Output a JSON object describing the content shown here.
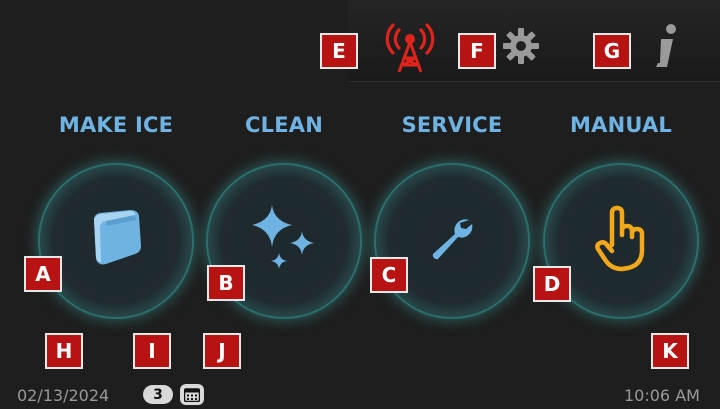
{
  "modes": {
    "make_ice": "MAKE ICE",
    "clean": "CLEAN",
    "service": "SERVICE",
    "manual": "MANUAL"
  },
  "callouts": {
    "a": "A",
    "b": "B",
    "c": "C",
    "d": "D",
    "e": "E",
    "f": "F",
    "g": "G",
    "h": "H",
    "i": "I",
    "j": "J",
    "k": "K"
  },
  "status": {
    "date": "02/13/2024",
    "badge_count": "3",
    "time": "10:06 AM"
  },
  "icons": {
    "signal": "signal-tower-icon",
    "settings": "gear-icon",
    "info": "info-icon",
    "make_ice": "ice-cube-icon",
    "clean": "sparkle-icon",
    "service": "wrench-icon",
    "manual": "hand-pointer-icon",
    "calendar": "calendar-icon"
  },
  "colors": {
    "background": "#1e1e1e",
    "label_blue": "#6fb3e3",
    "glow_teal": "#3b8d8b",
    "callout_red": "#b81313",
    "signal_red": "#e0231b",
    "hand_orange": "#f3a71a",
    "icon_blue": "#6fb3e3",
    "gray_icon": "#9a9a9a"
  }
}
